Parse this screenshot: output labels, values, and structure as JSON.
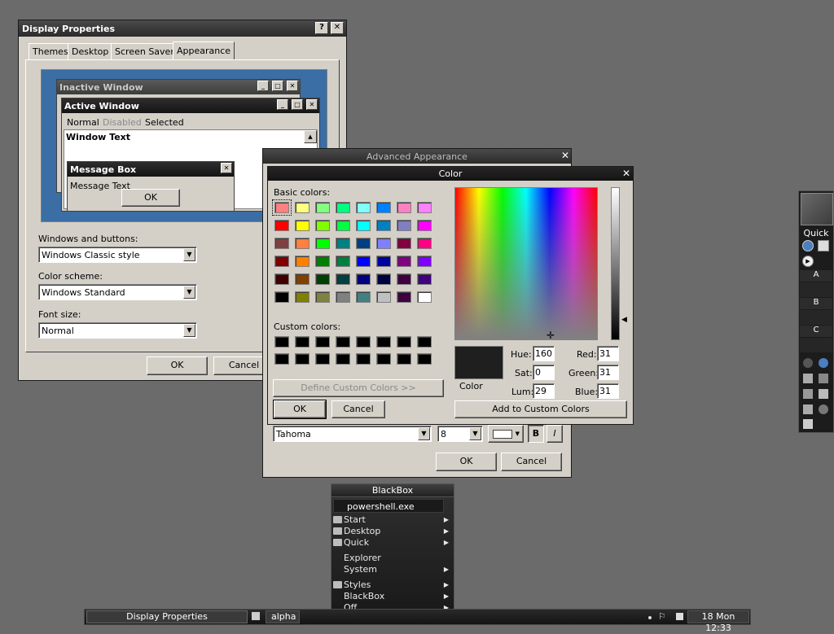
{
  "display_properties": {
    "title": "Display Properties",
    "help_btn": "?",
    "close_btn": "✕",
    "tabs": [
      "Themes",
      "Desktop",
      "Screen Saver",
      "Appearance"
    ],
    "preview": {
      "inactive_title": "Inactive Window",
      "active_title": "Active Window",
      "menu": [
        "Normal",
        "Disabled",
        "Selected"
      ],
      "window_text": "Window Text",
      "msgbox_title": "Message Box",
      "msgbox_text": "Message Text",
      "msgbox_ok": "OK"
    },
    "windows_buttons_label": "Windows and buttons:",
    "windows_buttons_value": "Windows Classic style",
    "color_scheme_label": "Color scheme:",
    "color_scheme_value": "Windows Standard",
    "font_size_label": "Font size:",
    "font_size_value": "Normal",
    "ok": "OK",
    "cancel": "Cancel"
  },
  "advanced_appearance": {
    "title": "Advanced Appearance",
    "font_value": "Tahoma",
    "size_value": "8",
    "bold": "B",
    "italic": "I",
    "ok": "OK",
    "cancel": "Cancel"
  },
  "color_dialog": {
    "title": "Color",
    "basic_colors_label": "Basic colors:",
    "basic_colors": [
      "#ff8080",
      "#ffff80",
      "#80ff80",
      "#00ff80",
      "#80ffff",
      "#0080ff",
      "#ff80c0",
      "#ff80ff",
      "#ff0000",
      "#ffff00",
      "#80ff00",
      "#00ff40",
      "#00ffff",
      "#0080c0",
      "#8080c0",
      "#ff00ff",
      "#804040",
      "#ff8040",
      "#00ff00",
      "#008080",
      "#004080",
      "#8080ff",
      "#800040",
      "#ff0080",
      "#800000",
      "#ff8000",
      "#008000",
      "#008040",
      "#0000ff",
      "#0000a0",
      "#800080",
      "#8000ff",
      "#400000",
      "#804000",
      "#004000",
      "#004040",
      "#000080",
      "#000040",
      "#400040",
      "#400080",
      "#000000",
      "#808000",
      "#808040",
      "#808080",
      "#408080",
      "#c0c0c0",
      "#400040",
      "#ffffff"
    ],
    "custom_colors_label": "Custom colors:",
    "custom_colors": [
      "#000000",
      "#000000",
      "#000000",
      "#000000",
      "#000000",
      "#000000",
      "#000000",
      "#000000",
      "#000000",
      "#000000",
      "#000000",
      "#000000",
      "#000000",
      "#000000",
      "#000000",
      "#000000"
    ],
    "define_custom": "Define Custom Colors >>",
    "ok": "OK",
    "cancel": "Cancel",
    "color_solid_label": "Color",
    "color_solid": "#1f1f1f",
    "hue_label": "Hue:",
    "hue": "160",
    "sat_label": "Sat:",
    "sat": "0",
    "lum_label": "Lum:",
    "lum": "29",
    "red_label": "Red:",
    "red": "31",
    "green_label": "Green:",
    "green": "31",
    "blue_label": "Blue:",
    "blue": "31",
    "add_custom": "Add to Custom Colors"
  },
  "toolbar_right": {
    "quick_label": "Quick",
    "workspaces": [
      "A",
      "B",
      "C"
    ]
  },
  "blackbox_menu": {
    "title": "BlackBox",
    "command": "powershell.exe",
    "items": [
      {
        "label": "Start",
        "folder": true,
        "sub": true
      },
      {
        "label": "Desktop",
        "folder": true,
        "sub": true
      },
      {
        "label": "Quick",
        "folder": true,
        "sub": true
      },
      {
        "label": "Explorer",
        "folder": false,
        "sub": false
      },
      {
        "label": "System",
        "folder": false,
        "sub": true
      },
      {
        "label": "Styles",
        "folder": true,
        "sub": true
      },
      {
        "label": "BlackBox",
        "folder": false,
        "sub": true
      },
      {
        "label": "Off",
        "folder": false,
        "sub": true
      }
    ]
  },
  "taskbar": {
    "task": "Display Properties",
    "workspace": "alpha",
    "clock": "18 Mon 12:33"
  }
}
